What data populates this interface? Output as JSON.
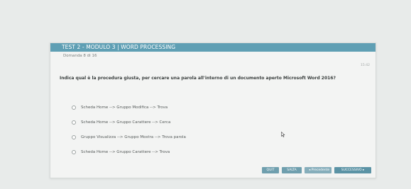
{
  "header": {
    "title": "TEST 2 - MODULO 3 | WORD PROCESSING",
    "subtitle": "Domanda 8 di 16",
    "timer": "15:42"
  },
  "question": {
    "text": "Indica qual è la procedura giusta, per cercare una parola all'interno di un documento aperto Microsoft Word 2016?"
  },
  "answers": [
    {
      "label": "Scheda Home --> Gruppo Modifica --> Trova"
    },
    {
      "label": "Scheda Home --> Gruppo Carattere --> Cerca"
    },
    {
      "label": "Gruppo Visualizza --> Gruppo Mostra --> Trova parola"
    },
    {
      "label": "Scheda Home --> Gruppo Carattere --> Trova"
    }
  ],
  "footer": {
    "quit_label": "QUIT",
    "skip_label": "SALTA",
    "prev_label": "◂ Precedente",
    "next_label": "SUCCESSIVO ▸"
  }
}
